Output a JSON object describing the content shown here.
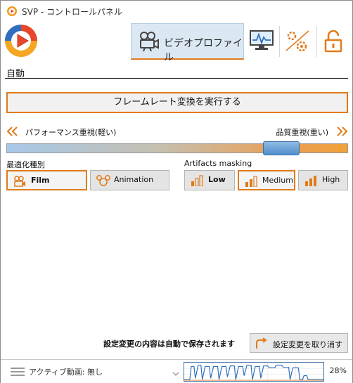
{
  "window": {
    "title": "SVP - コントロールパネル"
  },
  "tabs": {
    "video_profile_label": "ビデオプロファイル",
    "monitor_icon": "monitor-icon",
    "performance_icon": "gears-icon",
    "lock_icon": "lock-icon"
  },
  "section": {
    "title": "自動"
  },
  "run_button": {
    "label": "フレームレート変換を実行する"
  },
  "quality_slider": {
    "left_label": "パフォーマンス重視(軽い)",
    "right_label": "品質重視(重い)",
    "value": 0.84
  },
  "optimization": {
    "label": "最適化種別",
    "options": [
      {
        "label": "Film",
        "icon": "film-camera-icon",
        "selected": true
      },
      {
        "label": "Animation",
        "icon": "mouse-ears-icon",
        "selected": false
      }
    ]
  },
  "artifacts": {
    "label": "Artifacts masking",
    "options": [
      {
        "label": "Low",
        "selected": false
      },
      {
        "label": "Medium",
        "selected": true
      },
      {
        "label": "High",
        "selected": false
      }
    ]
  },
  "footer": {
    "save_note": "設定変更の内容は自動で保存されます",
    "undo_label": "設定変更を取り消す"
  },
  "status": {
    "active_video": "アクティブ動画: 無し",
    "cpu_percent": "28%"
  },
  "colors": {
    "accent": "#e07b1c",
    "selection_blue": "#4f8fcc"
  }
}
